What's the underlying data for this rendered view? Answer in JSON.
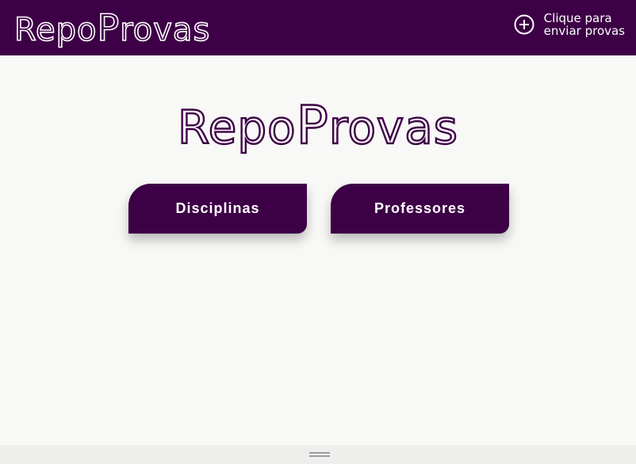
{
  "header": {
    "logo_prefix": "Repo",
    "logo_big": "P",
    "logo_suffix": "rovas",
    "send_line1": "Clique para",
    "send_line2": "enviar provas",
    "send_icon": "plus-circle-icon"
  },
  "main": {
    "logo_prefix": "Repo",
    "logo_big": "P",
    "logo_suffix": "rovas",
    "buttons": [
      {
        "label": "Disciplinas"
      },
      {
        "label": "Professores"
      }
    ]
  },
  "colors": {
    "primary": "#3d0046",
    "background": "#f8f8f6",
    "text_on_primary": "#ffffff"
  }
}
